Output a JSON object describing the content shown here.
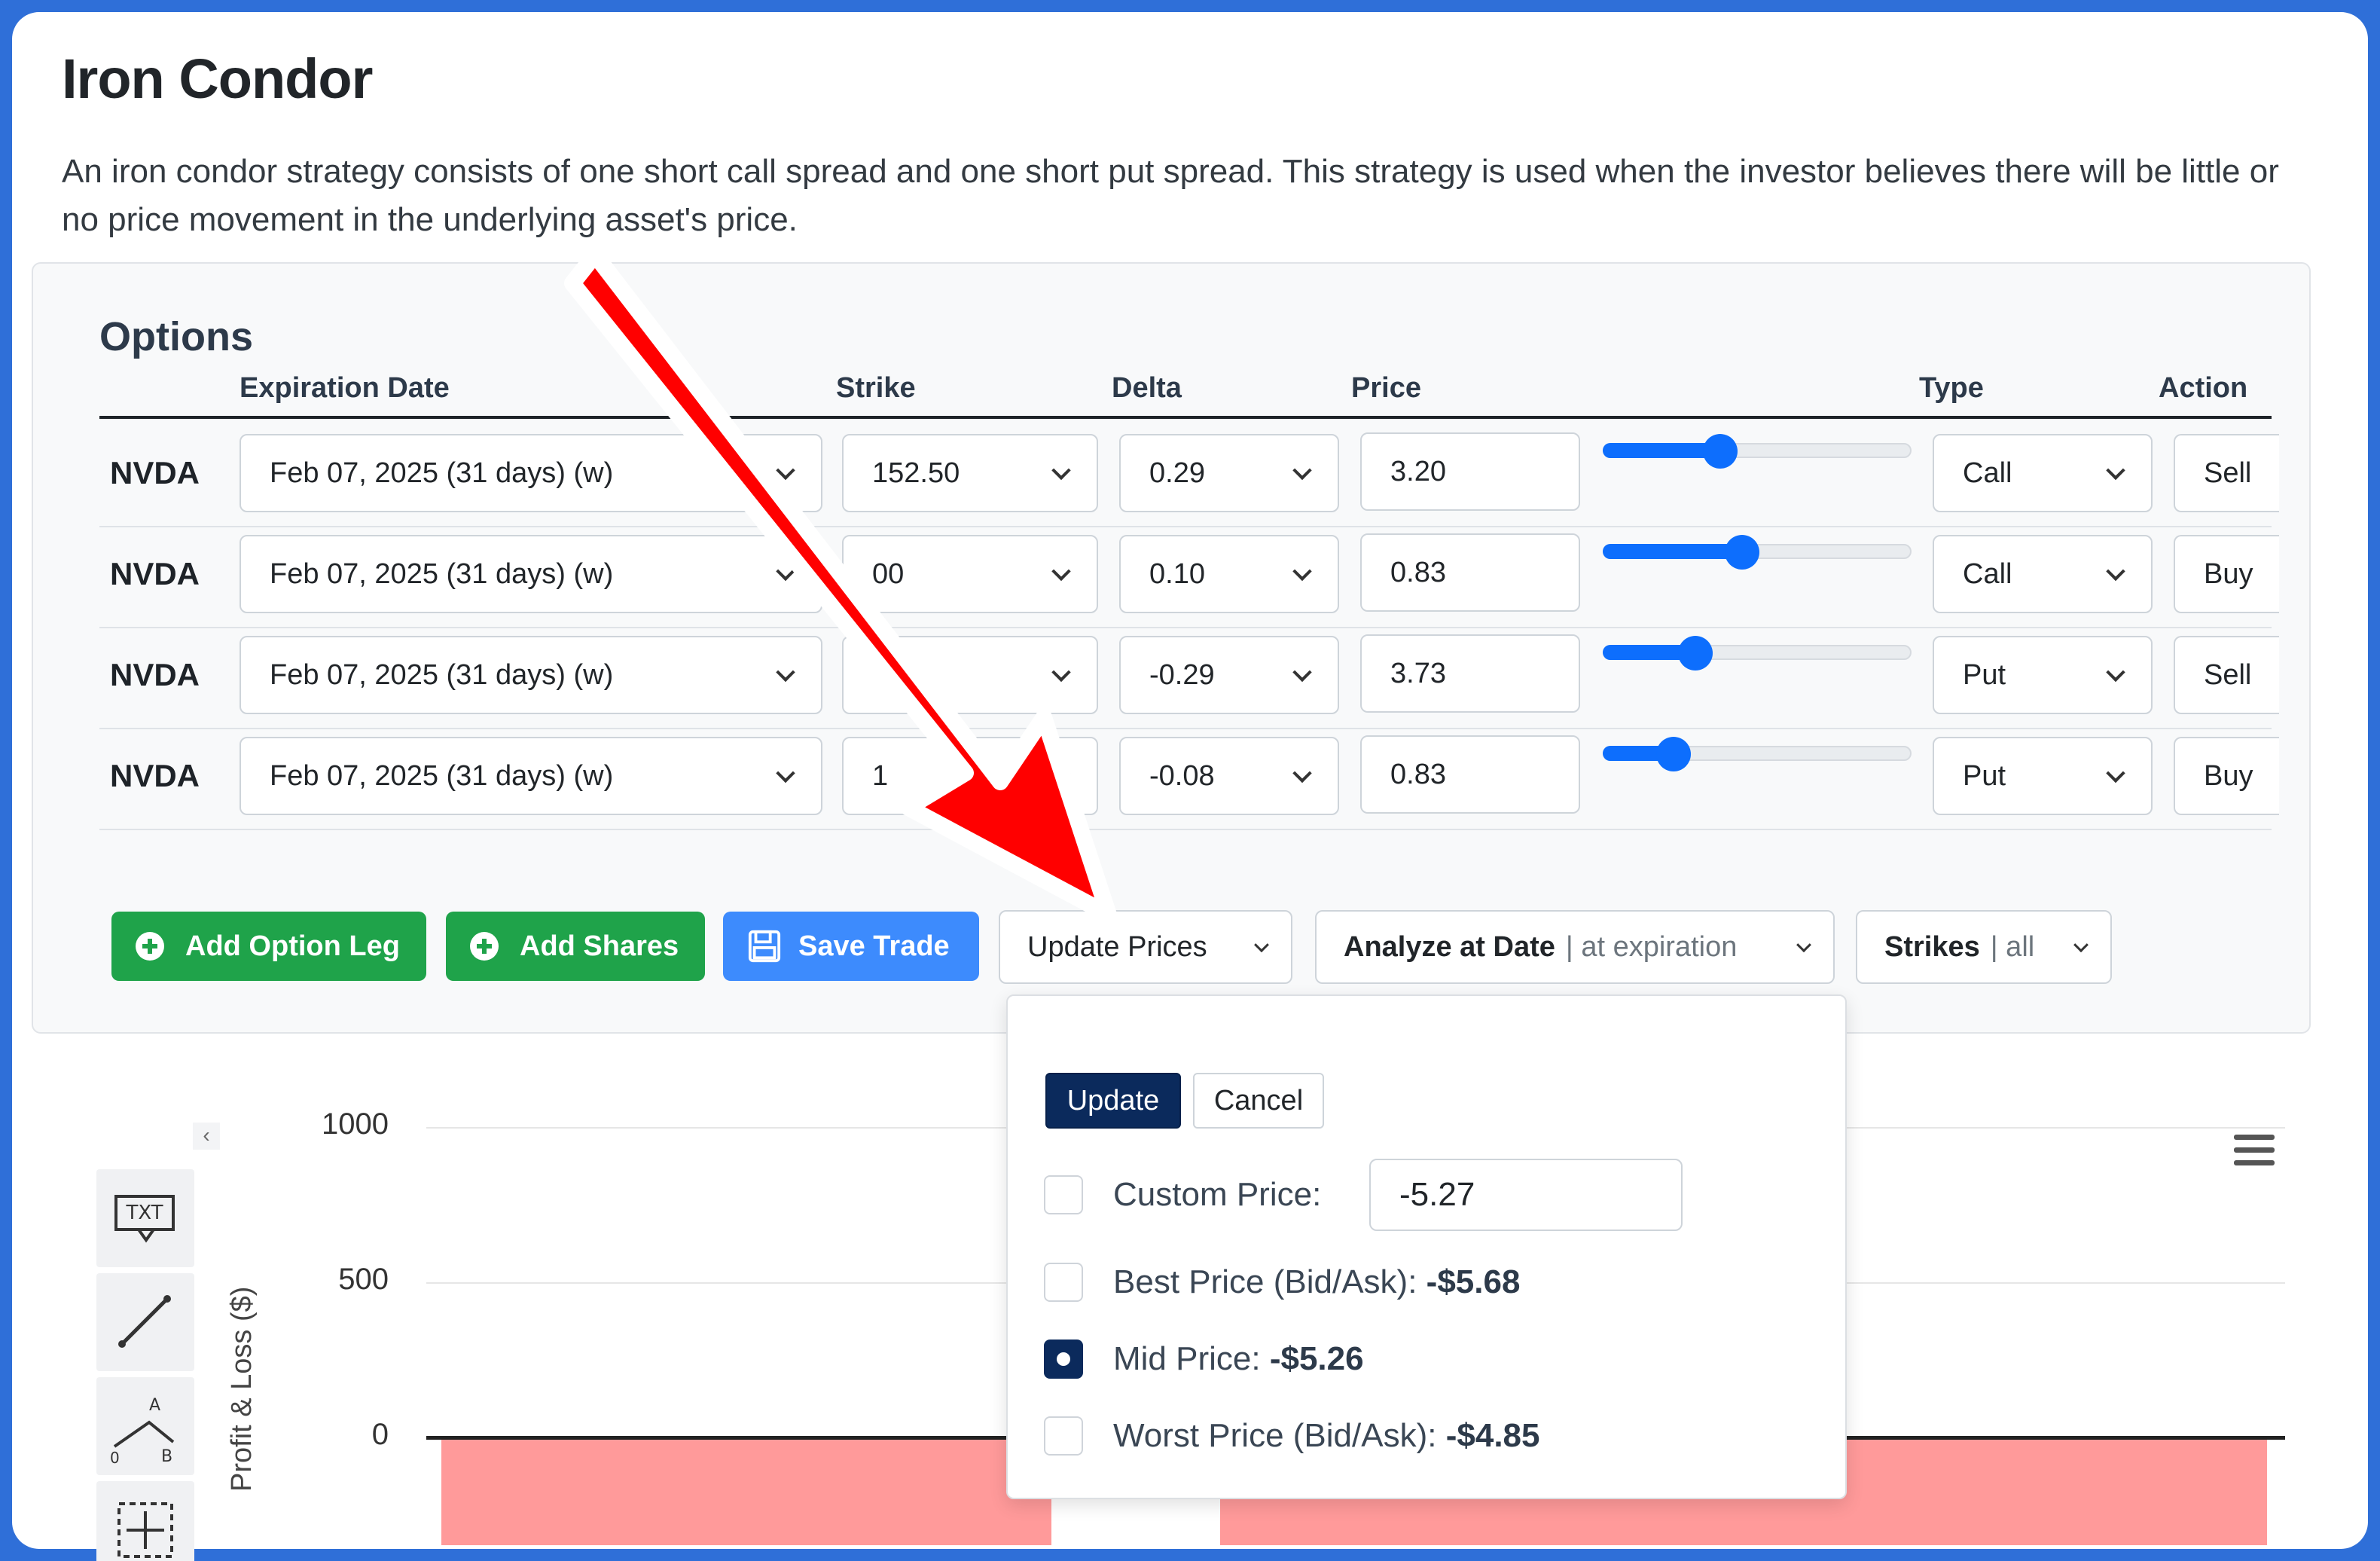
{
  "page": {
    "title": "Iron Condor",
    "description": "An iron condor strategy consists of one short call spread and one short put spread. This strategy is used when the investor believes there will be little or no price movement in the underlying asset's price."
  },
  "options": {
    "heading": "Options",
    "columns": {
      "expiration": "Expiration Date",
      "strike": "Strike",
      "delta": "Delta",
      "price": "Price",
      "type": "Type",
      "action": "Action"
    },
    "rows": [
      {
        "symbol": "NVDA",
        "expiration": "Feb 07, 2025 (31 days) (w)",
        "strike": "152.50",
        "delta": "0.29",
        "price": "3.20",
        "slider_fraction": 0.38,
        "type": "Call",
        "action": "Sell"
      },
      {
        "symbol": "NVDA",
        "expiration": "Feb 07, 2025 (31 days) (w)",
        "strike": "00",
        "delta": "0.10",
        "price": "0.83",
        "slider_fraction": 0.45,
        "type": "Call",
        "action": "Buy"
      },
      {
        "symbol": "NVDA",
        "expiration": "Feb 07, 2025 (31 days) (w)",
        "strike": "",
        "delta": "-0.29",
        "price": "3.73",
        "slider_fraction": 0.3,
        "type": "Put",
        "action": "Sell"
      },
      {
        "symbol": "NVDA",
        "expiration": "Feb 07, 2025 (31 days) (w)",
        "strike": "1",
        "delta": "-0.08",
        "price": "0.83",
        "slider_fraction": 0.23,
        "type": "Put",
        "action": "Buy"
      }
    ]
  },
  "toolbar": {
    "add_leg": "Add Option Leg",
    "add_shares": "Add Shares",
    "save_trade": "Save Trade",
    "update_prices": "Update Prices",
    "analyze_label": "Analyze at Date",
    "analyze_value": "| at expiration",
    "strikes_label": "Strikes",
    "strikes_value": "| all"
  },
  "update_dropdown": {
    "update_button": "Update",
    "cancel_button": "Cancel",
    "custom_label": "Custom Price:",
    "custom_value": "-5.27",
    "best_label": "Best Price (Bid/Ask):",
    "best_value": "-$5.68",
    "mid_label": "Mid Price:",
    "mid_value": "-$5.26",
    "worst_label": "Worst Price (Bid/Ask):",
    "worst_value": "-$4.85",
    "selected": "mid"
  },
  "chart": {
    "y_ticks": [
      "1000",
      "500",
      "0"
    ],
    "y_label": "Profit & Loss ($)",
    "tools": [
      "TXT",
      "line",
      "angle",
      "move"
    ]
  },
  "colors": {
    "buy_green": "#1fa34a",
    "save_blue": "#3d8bfd",
    "slider_blue": "#0d6efd",
    "loss_red": "#ff9a9a",
    "arrow_red": "#ff0000",
    "update_navy": "#0b2a5c"
  }
}
